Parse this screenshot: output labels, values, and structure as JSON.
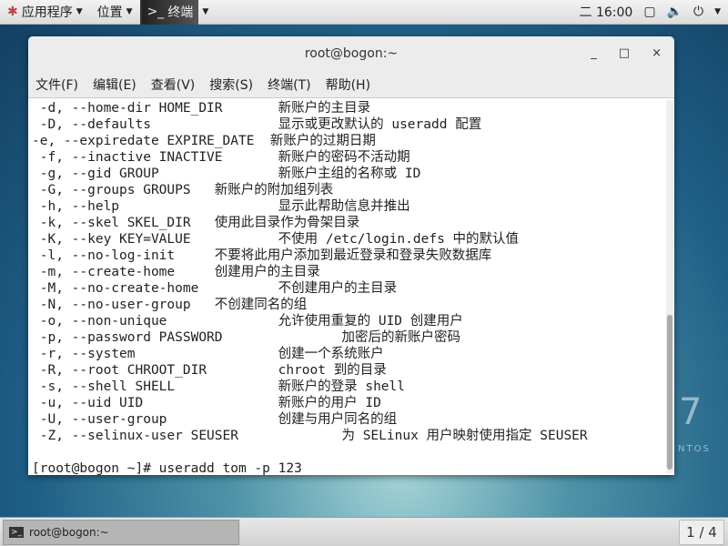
{
  "topbar": {
    "applications": "应用程序",
    "places": "位置",
    "terminal": "终端",
    "clock": "二 16:00"
  },
  "window": {
    "title": "root@bogon:~",
    "minimize": "_",
    "maximize": "□",
    "close": "×"
  },
  "menu": [
    "文件(F)",
    "编辑(E)",
    "查看(V)",
    "搜索(S)",
    "终端(T)",
    "帮助(H)"
  ],
  "terminal_lines": [
    " -d, --home-dir HOME_DIR       新账户的主目录",
    " -D, --defaults                显示或更改默认的 useradd 配置",
    "-e, --expiredate EXPIRE_DATE  新账户的过期日期",
    " -f, --inactive INACTIVE       新账户的密码不活动期",
    " -g, --gid GROUP               新账户主组的名称或 ID",
    " -G, --groups GROUPS   新账户的附加组列表",
    " -h, --help                    显示此帮助信息并推出",
    " -k, --skel SKEL_DIR   使用此目录作为骨架目录",
    " -K, --key KEY=VALUE           不使用 /etc/login.defs 中的默认值",
    " -l, --no-log-init     不要将此用户添加到最近登录和登录失败数据库",
    " -m, --create-home     创建用户的主目录",
    " -M, --no-create-home          不创建用户的主目录",
    " -N, --no-user-group   不创建同名的组",
    " -o, --non-unique              允许使用重复的 UID 创建用户",
    " -p, --password PASSWORD               加密后的新账户密码",
    " -r, --system                  创建一个系统账户",
    " -R, --root CHROOT_DIR         chroot 到的目录",
    " -s, --shell SHELL             新账户的登录 shell",
    " -u, --uid UID                 新账户的用户 ID",
    " -U, --user-group              创建与用户同名的组",
    " -Z, --selinux-user SEUSER             为 SELinux 用户映射使用指定 SEUSER",
    "",
    "[root@bogon ~]# useradd tom -p 123"
  ],
  "taskbar": {
    "task": "root@bogon:~",
    "workspace": "1 / 4"
  },
  "desktop": {
    "logo_number": "7",
    "logo_text": "NTOS"
  }
}
